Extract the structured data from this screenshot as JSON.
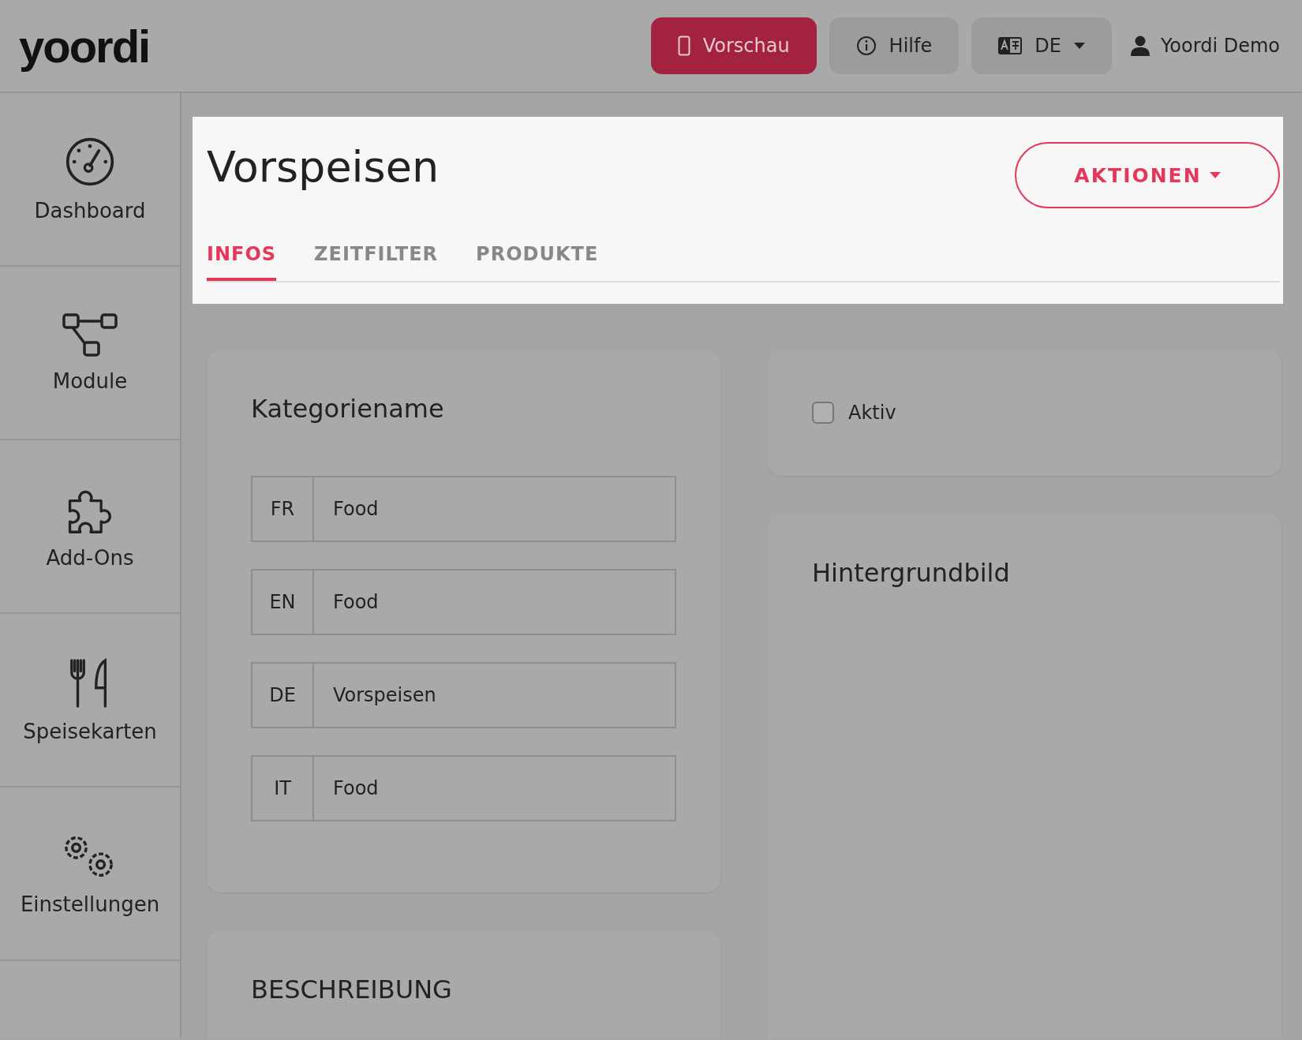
{
  "header": {
    "logo": "yoordi",
    "buttons": [
      {
        "kind": "preview",
        "label": "Vorschau"
      },
      {
        "kind": "help",
        "label": "Hilfe"
      },
      {
        "kind": "language",
        "label": "DE"
      }
    ],
    "user": "Yoordi Demo"
  },
  "sidebar": {
    "items": [
      {
        "kind": "dashboard",
        "label": "Dashboard"
      },
      {
        "kind": "modules",
        "label": "Module"
      },
      {
        "kind": "addons",
        "label": "Add-Ons"
      },
      {
        "kind": "menus",
        "label": "Speisekarten"
      },
      {
        "kind": "settings",
        "label": "Einstellungen"
      }
    ]
  },
  "page": {
    "title": "Vorspeisen",
    "actions": "AKTIONEN",
    "tabs": [
      {
        "label": "INFOS",
        "selected": true
      },
      {
        "label": "ZEITFILTER",
        "selected": false
      },
      {
        "label": "PRODUKTE",
        "selected": false
      }
    ]
  },
  "name_card": {
    "title": "Kategoriename",
    "fields": [
      {
        "lang": "FR",
        "value": "Food"
      },
      {
        "lang": "EN",
        "value": "Food"
      },
      {
        "lang": "DE",
        "value": "Vorspeisen"
      },
      {
        "lang": "IT",
        "value": "Food"
      }
    ]
  },
  "status_card": {
    "label": "Aktiv",
    "checked": false
  },
  "image_card": {
    "title": "Hintergrundbild"
  },
  "description_card": {
    "title": "BESCHREIBUNG"
  }
}
